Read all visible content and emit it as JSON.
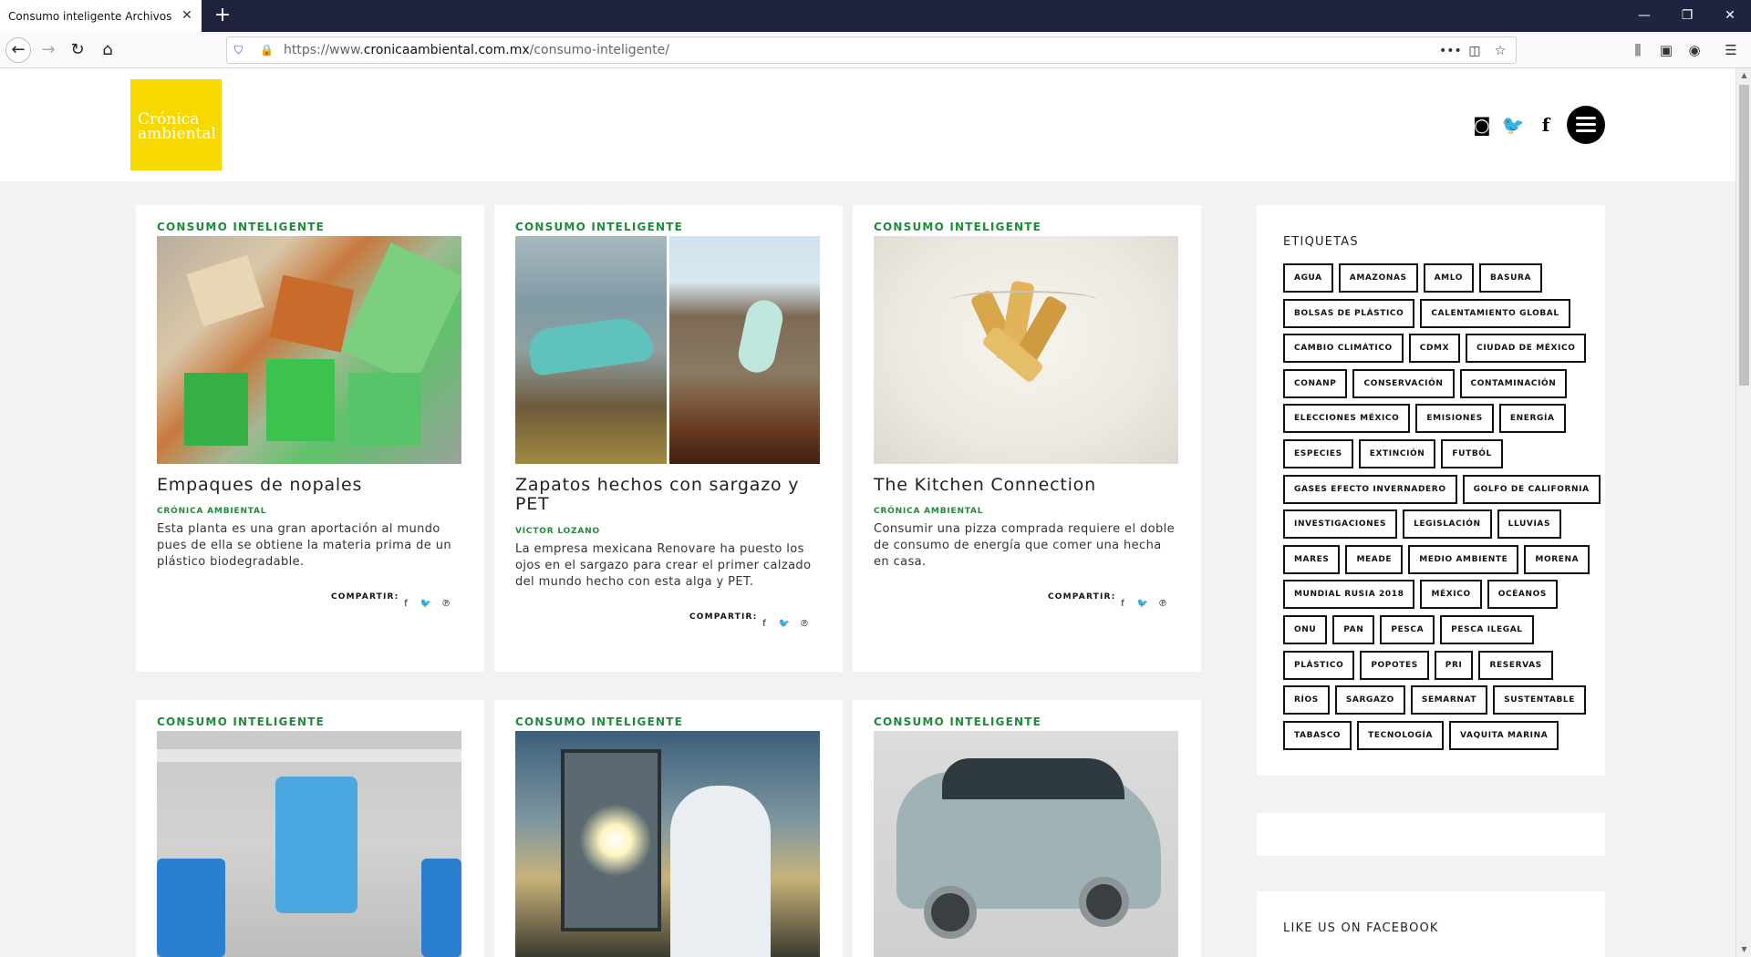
{
  "browser": {
    "tab_title": "Consumo inteligente Archivos - Cr",
    "url_prefix": "https://www.",
    "url_domain": "cronicaambiental.com.mx",
    "url_path": "/consumo-inteligente/"
  },
  "site": {
    "logo_line1": "Crónica",
    "logo_line2": "ambiental",
    "brand_color": "#f7d800"
  },
  "share_label": "COMPARTIR:",
  "posts": [
    {
      "category": "CONSUMO INTELIGENTE",
      "title": "Empaques de nopales",
      "author": "CRÓNICA AMBIENTAL",
      "excerpt": "Esta planta es una gran aportación al mundo pues de ella se obtiene la materia prima de un plástico biodegradable."
    },
    {
      "category": "CONSUMO INTELIGENTE",
      "title": "Zapatos hechos con sargazo y PET",
      "author": "VÍCTOR LOZANO",
      "excerpt": "La empresa mexicana Renovare ha puesto los ojos en el sargazo para crear el primer calzado del mundo hecho con esta alga y PET."
    },
    {
      "category": "CONSUMO INTELIGENTE",
      "title": "The Kitchen Connection",
      "author": "CRÓNICA AMBIENTAL",
      "excerpt": "Consumir una pizza comprada requiere el doble de consumo de energía que comer una hecha en casa."
    },
    {
      "category": "CONSUMO INTELIGENTE"
    },
    {
      "category": "CONSUMO INTELIGENTE"
    },
    {
      "category": "CONSUMO INTELIGENTE"
    }
  ],
  "sidebar": {
    "tags_title": "ETIQUETAS",
    "tag_rows": [
      [
        "AGUA",
        "AMAZONAS",
        "AMLO",
        "BASURA"
      ],
      [
        "BOLSAS DE PLÁSTICO",
        "CALENTAMIENTO GLOBAL"
      ],
      [
        "CAMBIO CLIMÁTICO",
        "CDMX",
        "CIUDAD DE MÉXICO"
      ],
      [
        "CONANP",
        "CONSERVACIÓN",
        "CONTAMINACIÓN"
      ],
      [
        "ELECCIONES MÉXICO",
        "EMISIONES",
        "ENERGÍA"
      ],
      [
        "ESPECIES",
        "EXTINCIÓN",
        "FUTBÓL"
      ],
      [
        "GASES EFECTO INVERNADERO",
        "GOLFO DE CALIFORNIA"
      ],
      [
        "INVESTIGACIONES",
        "LEGISLACIÓN",
        "LLUVIAS"
      ],
      [
        "MARES",
        "MEADE",
        "MEDIO AMBIENTE",
        "MORENA"
      ],
      [
        "MUNDIAL RUSIA 2018",
        "MÉXICO",
        "OCÉANOS"
      ],
      [
        "ONU",
        "PAN",
        "PESCA",
        "PESCA ILEGAL"
      ],
      [
        "PLÁSTICO",
        "POPOTES",
        "PRI",
        "RESERVAS"
      ],
      [
        "RÍOS",
        "SARGAZO",
        "SEMARNAT",
        "SUSTENTABLE"
      ],
      [
        "TABASCO",
        "TECNOLOGÍA",
        "VAQUITA MARINA"
      ]
    ],
    "facebook_title": "LIKE US ON FACEBOOK"
  }
}
